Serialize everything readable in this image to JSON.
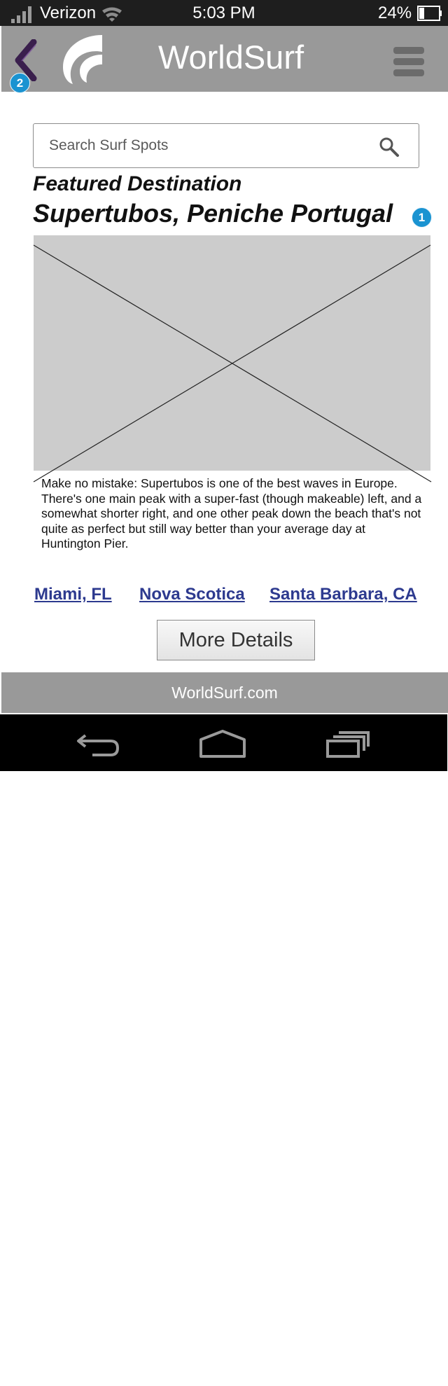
{
  "status_bar": {
    "carrier": "Verizon",
    "time": "5:03 PM",
    "battery": "24%",
    "icons": [
      "signal-icon",
      "wifi-icon",
      "battery-icon"
    ]
  },
  "header": {
    "back_badge": "2",
    "title": "WorldSurf",
    "icons": [
      "back-arrow-icon",
      "logo-wave-icon",
      "hamburger-menu-icon"
    ]
  },
  "search": {
    "placeholder": "Search Surf Spots",
    "value": "",
    "icon": "search-icon"
  },
  "featured": {
    "label": "Featured Destination",
    "title": "Supertubos, Peniche Portugal",
    "badge": "1",
    "image": "image-placeholder",
    "description": "Make no mistake: Supertubos is one of the best waves in Europe. There's one main peak with a super-fast (though makeable) left, and a somewhat shorter right, and one other peak down the beach that's not quite as perfect but still way better than your average day at Huntington Pier."
  },
  "destinations": [
    {
      "label": "Miami, FL"
    },
    {
      "label": "Nova Scotica"
    },
    {
      "label": "Santa Barbara, CA"
    }
  ],
  "more_details_label": "More Details",
  "footer": {
    "text": "WorldSurf.com"
  },
  "nav_bar": {
    "icons": [
      "nav-back-icon",
      "nav-home-icon",
      "nav-recents-icon"
    ]
  },
  "colors": {
    "header_bg": "#999999",
    "status_bg": "#1e1e1e",
    "badge": "#1a93d1",
    "link": "#2d3a8f",
    "back_arrow": "#3a1f4d",
    "image_placeholder": "#cccccc"
  }
}
